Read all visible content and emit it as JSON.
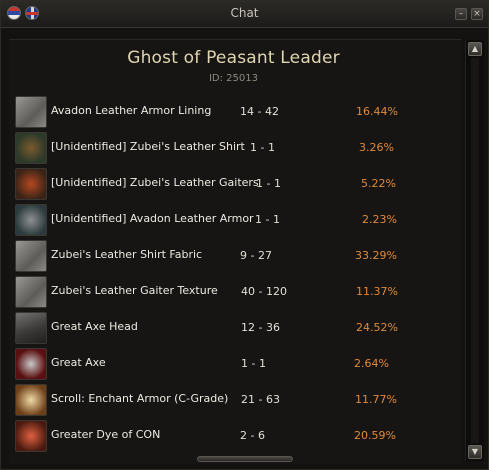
{
  "window": {
    "title": "Chat"
  },
  "boss": {
    "name": "Ghost of Peasant Leader",
    "id": "ID: 25013"
  },
  "drops": [
    {
      "name": "Avadon Leather Armor Lining",
      "count": "14 - 42",
      "chance": "16.44%",
      "icon": "fabric-icon"
    },
    {
      "name": "[Unidentified] Zubei's Leather Shirt",
      "count": "1 - 1",
      "chance": "3.26%",
      "icon": "leather-shirt-icon"
    },
    {
      "name": "[Unidentified] Zubei's Leather Gaiters",
      "count": "1 - 1",
      "chance": "5.22%",
      "icon": "leather-gaiters-icon"
    },
    {
      "name": "[Unidentified] Avadon Leather Armor",
      "count": "1 - 1",
      "chance": "2.23%",
      "icon": "leather-armor-icon"
    },
    {
      "name": "Zubei's Leather Shirt Fabric",
      "count": "9 - 27",
      "chance": "33.29%",
      "icon": "fabric-icon"
    },
    {
      "name": "Zubei's Leather Gaiter Texture",
      "count": "40 - 120",
      "chance": "11.37%",
      "icon": "fabric-icon"
    },
    {
      "name": "Great Axe Head",
      "count": "12 - 36",
      "chance": "24.52%",
      "icon": "axe-head-icon"
    },
    {
      "name": "Great Axe",
      "count": "1 - 1",
      "chance": "2.64%",
      "icon": "axe-icon"
    },
    {
      "name": "Scroll: Enchant Armor (C-Grade)",
      "count": "21 - 63",
      "chance": "11.77%",
      "icon": "scroll-icon"
    },
    {
      "name": "Greater Dye of CON",
      "count": "2 - 6",
      "chance": "20.59%",
      "icon": "dye-icon"
    }
  ],
  "colors": {
    "chance": "#e08a3a",
    "title": "#e0d6b0",
    "background": "#161514"
  }
}
